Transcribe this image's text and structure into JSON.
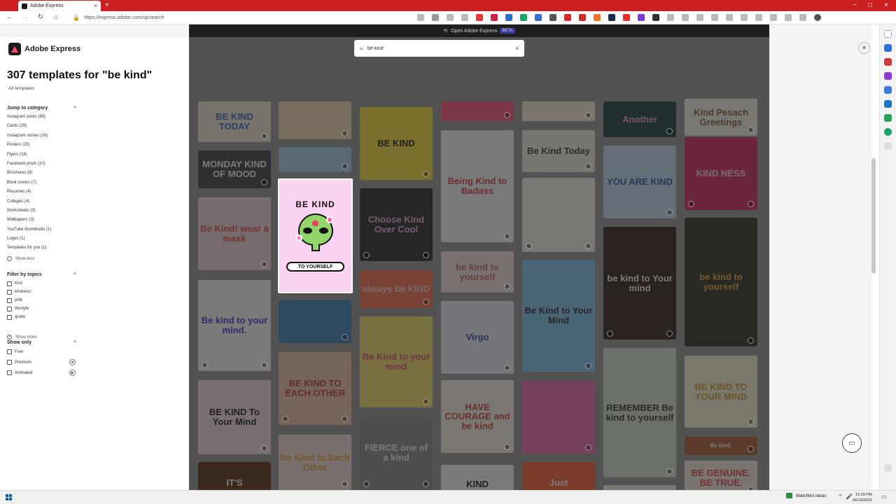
{
  "browser": {
    "tab_title": "Adobe Express",
    "url": "https://express.adobe.com/sp/search",
    "new_tab": "+",
    "tab_close": "×",
    "window_controls": [
      "−",
      "□",
      "×"
    ]
  },
  "banner": {
    "label": "Open Adobe Express",
    "badge": "BETA"
  },
  "sidebar": {
    "brand": "Adobe Express",
    "results_title": "307 templates for \"be kind\"",
    "all_templates": "All templates",
    "categories_heading": "Jump to category",
    "categories": [
      "Instagram posts (88)",
      "Cards (29)",
      "Instagram stories (26)",
      "Posters (25)",
      "Flyers (18)",
      "Facebook posts (10)",
      "Brochures (8)",
      "Book covers (7)",
      "Resumes (4)",
      "Collages (4)",
      "Worksheets (3)",
      "Wallpapers (3)",
      "YouTube thumbnails (1)",
      "Logos (1)",
      "Templates for you (1)"
    ],
    "show_less": "Show less",
    "topics_heading": "Filter by topics",
    "topics": [
      "kind",
      "kindness",
      "pink",
      "lifestyle",
      "quote"
    ],
    "show_more": "Show more",
    "only_heading": "Show only",
    "only_options": [
      "Free",
      "Premium",
      "Animated"
    ]
  },
  "search": {
    "value": "be kind",
    "clear": "×"
  },
  "focus_card": {
    "top_text": "BE KIND",
    "bottom_text": "TO YOURSELF"
  },
  "cards": [
    {
      "id": "c1",
      "text": "BE KIND TODAY",
      "color": "#f6ecd7",
      "fg": "#3060c8"
    },
    {
      "id": "c2",
      "text": "MONDAY KIND OF MOOD",
      "color": "#3b3b3b",
      "fg": "#ffffff"
    },
    {
      "id": "c3",
      "text": "Be Kind! wear a mask",
      "color": "#f6d9de",
      "fg": "#e2463c"
    },
    {
      "id": "c4",
      "text": "Be kind to your mind.",
      "color": "#ffffff",
      "fg": "#3a2bd9"
    },
    {
      "id": "c5",
      "text": "BE KIND To Your Mind",
      "color": "#fce3e8",
      "fg": "#111111"
    },
    {
      "id": "c6",
      "text": "IT'S",
      "color": "#5a2c0f",
      "fg": "#ffffff"
    },
    {
      "id": "c7",
      "text": "",
      "color": "#f3ddb0",
      "fg": "#333333"
    },
    {
      "id": "c8",
      "text": "",
      "color": "#a9d4ef",
      "fg": "#333333"
    },
    {
      "id": "c9",
      "text": "",
      "color": "#3b7fb5",
      "fg": "#ffffff"
    },
    {
      "id": "c10",
      "text": "BE KIND TO EACH OTHER",
      "color": "#f5c6a4",
      "fg": "#c0392b"
    },
    {
      "id": "c11",
      "text": "Be Kind to Each Other",
      "color": "#fbe3da",
      "fg": "#e9a033"
    },
    {
      "id": "c12",
      "text": "BE KIND",
      "color": "#ffe336",
      "fg": "#111111"
    },
    {
      "id": "c13",
      "text": "Choose Kind Over Cool",
      "color": "#222222",
      "fg": "#f7b4e3"
    },
    {
      "id": "c14",
      "text": "always be KIND",
      "color": "#ff6b4a",
      "fg": "#fbd3d3"
    },
    {
      "id": "c15",
      "text": "Be Kind to your mind",
      "color": "#fde56b",
      "fg": "#e8457f"
    },
    {
      "id": "c16",
      "text": "FIERCE one of a kind",
      "color": "#8a8a8a",
      "fg": "#ffffff"
    },
    {
      "id": "c17",
      "text": "",
      "color": "#ff4f7b",
      "fg": "#ffffff"
    },
    {
      "id": "c18",
      "text": "Being Kind to Badass",
      "color": "#ffffff",
      "fg": "#d9333f"
    },
    {
      "id": "c19",
      "text": "be kind to yourself",
      "color": "#fbe7e4",
      "fg": "#c06a5a"
    },
    {
      "id": "c20",
      "text": "Virgo",
      "color": "#f1f3fb",
      "fg": "#3140a0"
    },
    {
      "id": "c21",
      "text": "HAVE COURAGE and be kind",
      "color": "#fff6ea",
      "fg": "#d2412a"
    },
    {
      "id": "c22",
      "text": "KIND",
      "color": "#ffffff",
      "fg": "#111111"
    },
    {
      "id": "c23",
      "text": "",
      "color": "#fff0dd",
      "fg": "#333333"
    },
    {
      "id": "c24",
      "text": "Be Kind Today",
      "color": "#f7f1e5",
      "fg": "#333333"
    },
    {
      "id": "c25",
      "text": "",
      "color": "#fbf6ee",
      "fg": "#333333"
    },
    {
      "id": "c26",
      "text": "Be Kind to Your Mind",
      "color": "#82c9f3",
      "fg": "#222222"
    },
    {
      "id": "c27",
      "text": "",
      "color": "#f26ab2",
      "fg": "#222222"
    },
    {
      "id": "c28",
      "text": "Just",
      "color": "#ff5b2e",
      "fg": "#ffffff"
    },
    {
      "id": "c29",
      "text": "Another",
      "color": "#16363a",
      "fg": "#f7a8d0"
    },
    {
      "id": "c30",
      "text": "YOU ARE KIND",
      "color": "#c8dff5",
      "fg": "#2c4ea5"
    },
    {
      "id": "c31",
      "text": "be kind to Your mind",
      "color": "#2a1a10",
      "fg": "#ffffff"
    },
    {
      "id": "c32",
      "text": "REMEMBER Be kind to yourself",
      "color": "#d8e6cf",
      "fg": "#2c2c2c"
    },
    {
      "id": "c33",
      "text": "Kind Pesach Greetings",
      "color": "#fdf7ea",
      "fg": "#7a5a2b"
    },
    {
      "id": "c34",
      "text": "KIND NESS",
      "color": "#d8235c",
      "fg": "#ffd7e4"
    },
    {
      "id": "c35",
      "text": "be kind to yourself",
      "color": "#2b2b1d",
      "fg": "#f0a33b"
    },
    {
      "id": "c36",
      "text": "BE KIND TO YOUR MIND",
      "color": "#fff7dc",
      "fg": "#d69a22"
    },
    {
      "id": "c37",
      "text": "Be kind.",
      "color": "#b35a2e",
      "fg": "#ffffff"
    },
    {
      "id": "c38",
      "text": "BE GENUINE. BE TRUE.",
      "color": "#fff2e4",
      "fg": "#e2403a"
    }
  ],
  "taskbar": {
    "watchlist": "Watchlist ideas",
    "time": "12:29 PM",
    "date": "06/13/2023"
  },
  "colors": {
    "brand_red": "#cc1f1f",
    "overlay": "#525252",
    "focus_bg": "#fbd3f2",
    "alien_green": "#93d56a"
  }
}
